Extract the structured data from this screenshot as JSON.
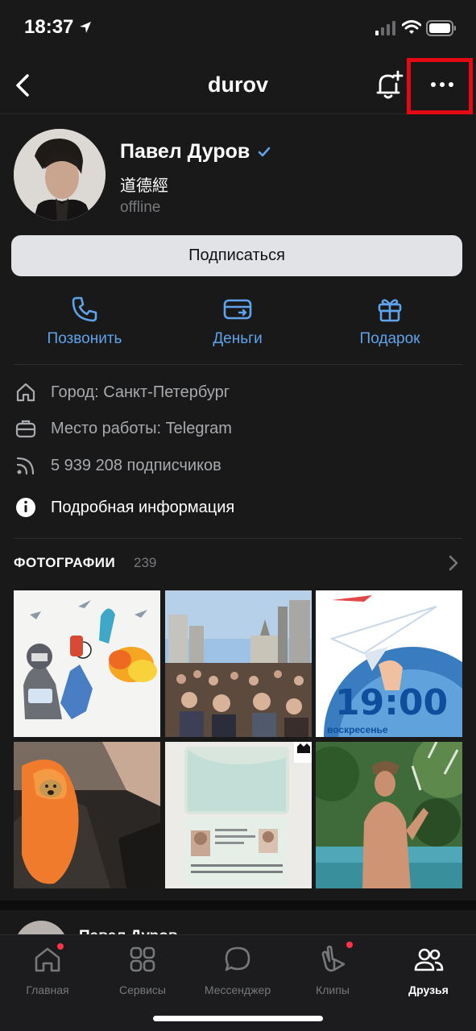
{
  "status_bar": {
    "time": "18:37"
  },
  "nav": {
    "title": "durov"
  },
  "profile": {
    "name": "Павел Дуров",
    "status": "道德經",
    "presence": "offline"
  },
  "subscribe_label": "Подписаться",
  "actions": [
    {
      "label": "Позвонить",
      "icon": "phone-icon"
    },
    {
      "label": "Деньги",
      "icon": "money-card-icon"
    },
    {
      "label": "Подарок",
      "icon": "gift-icon"
    }
  ],
  "info": {
    "city": "Город: Санкт-Петербург",
    "work": "Место работы: Telegram",
    "followers": "5 939 208 подписчиков",
    "details": "Подробная информация"
  },
  "photos": {
    "title": "ФОТОГРАФИИ",
    "count": "239",
    "poster_time": "19:00",
    "poster_day": "воскресенье"
  },
  "feed_peek": {
    "name": "Павел Дуров"
  },
  "tabs": [
    {
      "label": "Главная",
      "icon": "home-icon",
      "badge": true
    },
    {
      "label": "Сервисы",
      "icon": "services-icon",
      "badge": false
    },
    {
      "label": "Мессенджер",
      "icon": "chat-icon",
      "badge": false
    },
    {
      "label": "Клипы",
      "icon": "clips-icon",
      "badge": true
    },
    {
      "label": "Друзья",
      "icon": "friends-icon",
      "badge": false,
      "active": true
    }
  ],
  "colors": {
    "background": "#19191a",
    "accent": "#5fa3eb",
    "highlight_box": "#e50914",
    "badge": "#ff3347"
  }
}
